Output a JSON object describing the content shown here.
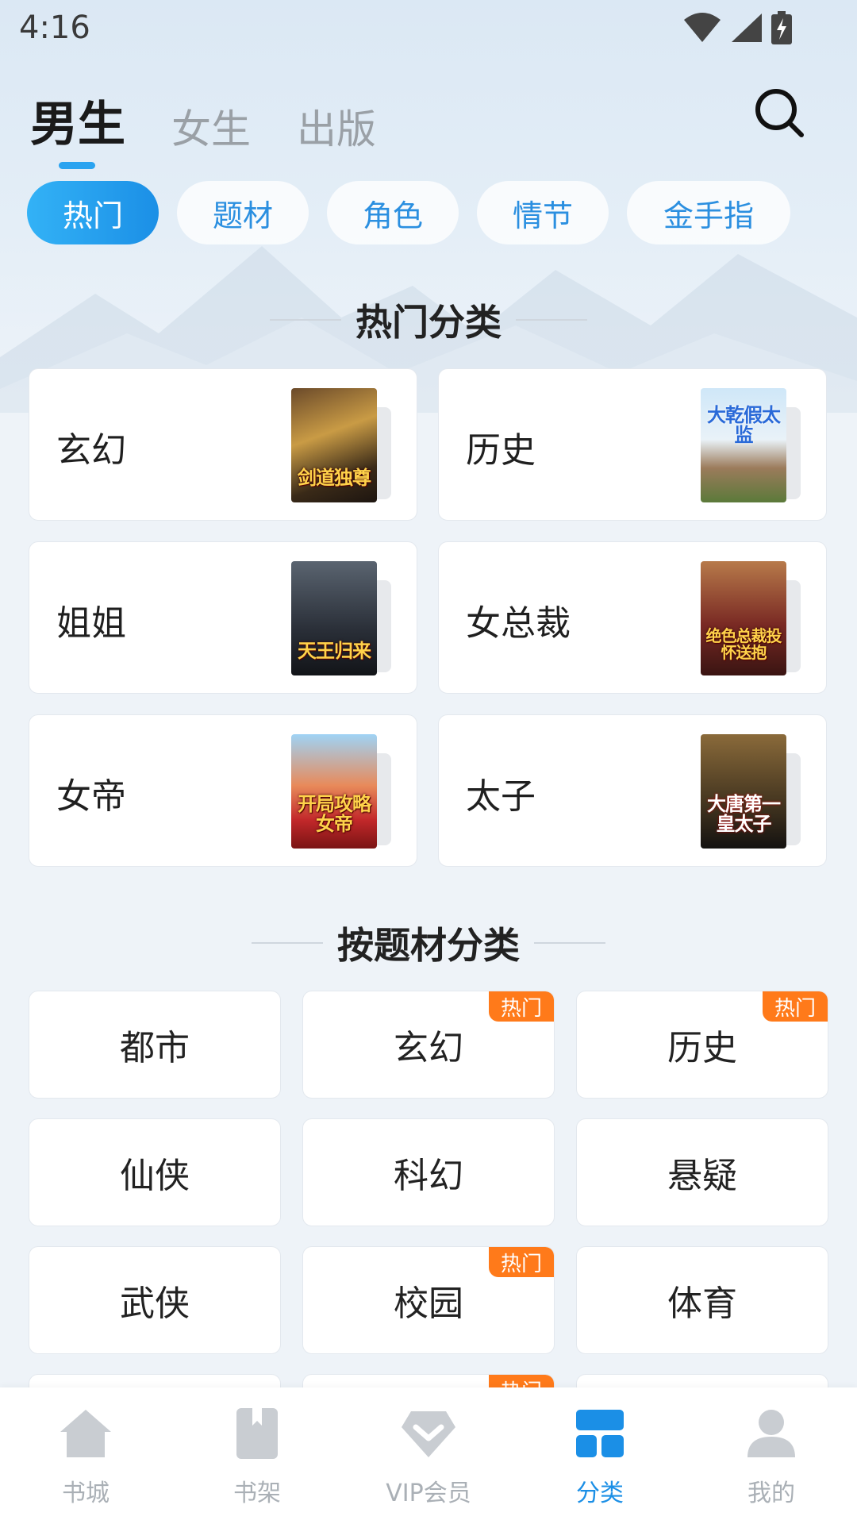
{
  "status_bar": {
    "time": "4:16"
  },
  "top_tabs": [
    {
      "label": "男生",
      "active": true
    },
    {
      "label": "女生",
      "active": false
    },
    {
      "label": "出版",
      "active": false
    }
  ],
  "chips": [
    {
      "label": "热门",
      "active": true
    },
    {
      "label": "题材",
      "active": false
    },
    {
      "label": "角色",
      "active": false
    },
    {
      "label": "情节",
      "active": false
    },
    {
      "label": "金手指",
      "active": false
    }
  ],
  "hot_section": {
    "title": "热门分类",
    "cards": [
      {
        "label": "玄幻",
        "cover_title": "剑道独尊"
      },
      {
        "label": "历史",
        "cover_title": "大乾假太监"
      },
      {
        "label": "姐姐",
        "cover_title": "天王归来"
      },
      {
        "label": "女总裁",
        "cover_title": "绝色总裁投怀送抱"
      },
      {
        "label": "女帝",
        "cover_title": "开局攻略女帝"
      },
      {
        "label": "太子",
        "cover_title": "大唐第一皇太子"
      }
    ]
  },
  "theme_section": {
    "title": "按题材分类",
    "badge_label": "热门",
    "items": [
      {
        "label": "都市",
        "hot": false
      },
      {
        "label": "玄幻",
        "hot": true
      },
      {
        "label": "历史",
        "hot": true
      },
      {
        "label": "仙侠",
        "hot": false
      },
      {
        "label": "科幻",
        "hot": false
      },
      {
        "label": "悬疑",
        "hot": false
      },
      {
        "label": "武侠",
        "hot": false
      },
      {
        "label": "校园",
        "hot": true
      },
      {
        "label": "体育",
        "hot": false
      },
      {
        "label": "",
        "hot": false
      },
      {
        "label": "",
        "hot": true
      },
      {
        "label": "",
        "hot": false
      }
    ]
  },
  "bottom_nav": [
    {
      "label": "书城",
      "icon": "home-icon",
      "active": false
    },
    {
      "label": "书架",
      "icon": "bookshelf-icon",
      "active": false
    },
    {
      "label": "VIP会员",
      "icon": "vip-diamond-icon",
      "active": false
    },
    {
      "label": "分类",
      "icon": "category-icon",
      "active": true
    },
    {
      "label": "我的",
      "icon": "profile-icon",
      "active": false
    }
  ],
  "colors": {
    "accent": "#1b8fe6",
    "hot_badge": "#ff7a1a",
    "inactive": "#aab0b6"
  }
}
